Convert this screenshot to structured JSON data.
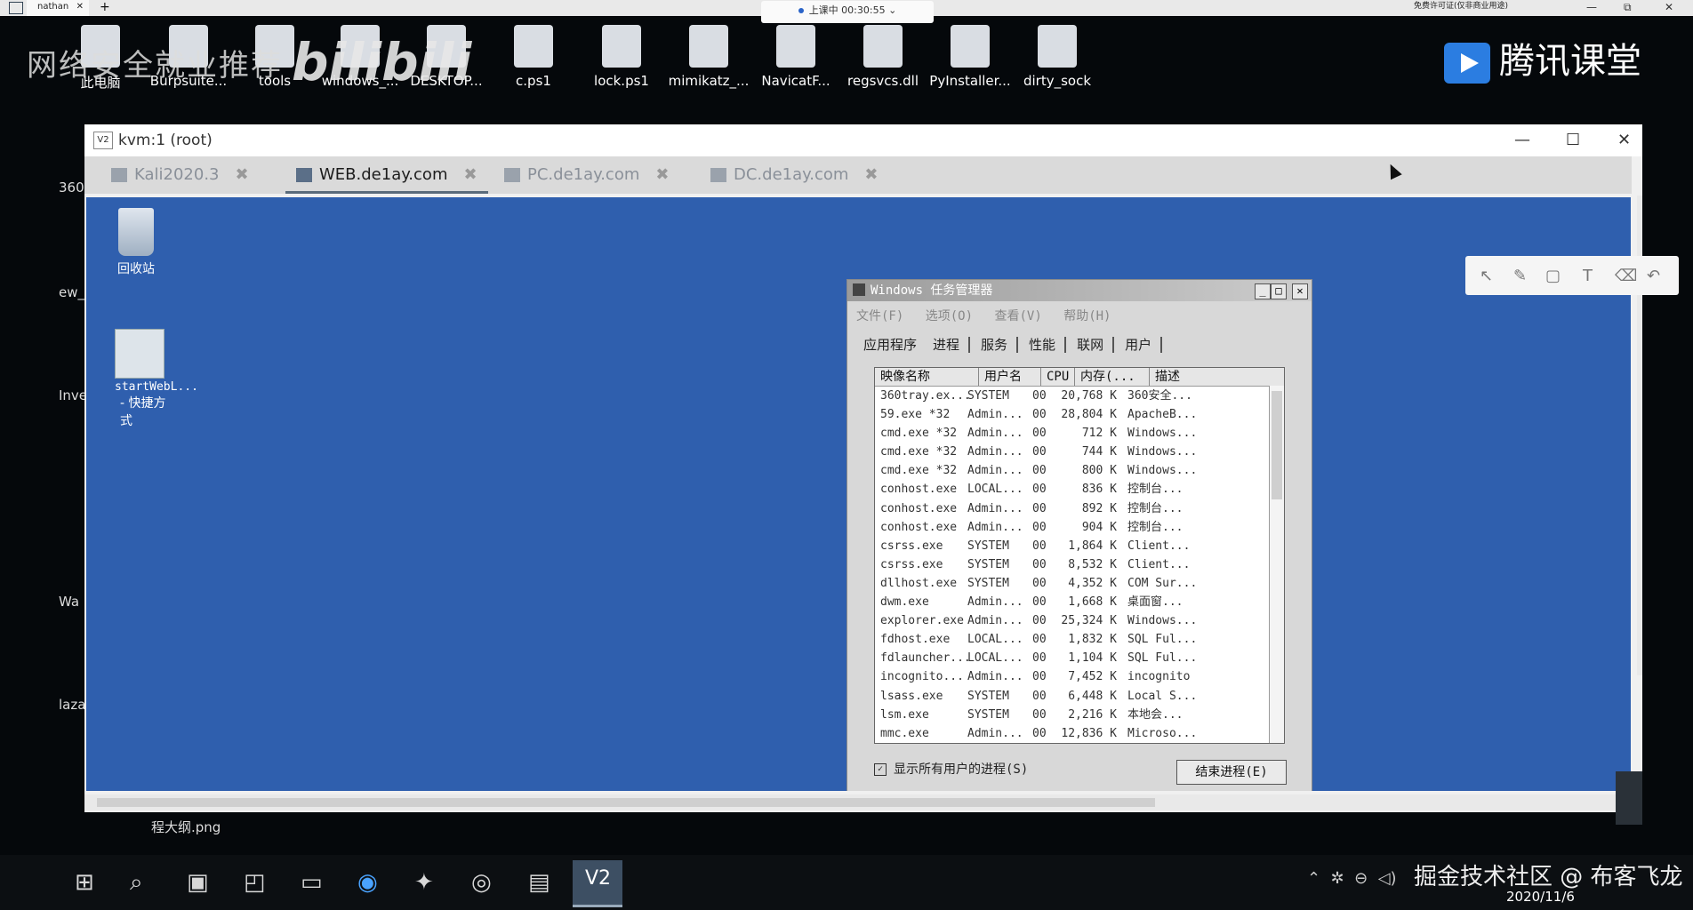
{
  "browser": {
    "tab_label": "nathan",
    "tab_close": "✕",
    "new_tab": "+",
    "class_status": "上课中 00:30:55",
    "top_right_text": "免费许可证(仅非商业用途)",
    "window_controls": [
      "—",
      "⧉",
      "✕"
    ]
  },
  "desktop_icons": [
    {
      "label": "此电脑",
      "icon": "pc-icon"
    },
    {
      "label": "Burpsuite...",
      "icon": "file-icon"
    },
    {
      "label": "tools",
      "icon": "folder-icon"
    },
    {
      "label": "windows_...",
      "icon": "file-icon"
    },
    {
      "label": "DESKTOP...",
      "icon": "file-icon"
    },
    {
      "label": "c.ps1",
      "icon": "script-icon"
    },
    {
      "label": "lock.ps1",
      "icon": "script-icon"
    },
    {
      "label": "mimikatz_...",
      "icon": "archive-icon"
    },
    {
      "label": "NavicatF...",
      "icon": "file-icon"
    },
    {
      "label": "regsvcs.dll",
      "icon": "dll-icon"
    },
    {
      "label": "PyInstaller...",
      "icon": "archive-icon"
    },
    {
      "label": "dirty_sock",
      "icon": "file-icon"
    }
  ],
  "watermark_left": "网络安全就业推荐",
  "watermark_bili": "bilibili",
  "tencent_brand": "腾讯课堂",
  "left_cut_labels": [
    "360",
    "ew_",
    "Inve",
    "Wa",
    "laza"
  ],
  "kvm": {
    "title": "kvm:1 (root)",
    "icon_text": "V2",
    "controls": [
      "—",
      "☐",
      "✕"
    ],
    "tabs": [
      {
        "label": "Kali2020.3",
        "active": false
      },
      {
        "label": "WEB.de1ay.com",
        "active": true
      },
      {
        "label": "PC.de1ay.com",
        "active": false
      },
      {
        "label": "DC.de1ay.com",
        "active": false
      }
    ],
    "tab_close": "✖"
  },
  "remote": {
    "recycle_label": "回收站",
    "shortcut_label_1": "startWebL...",
    "shortcut_label_2": "- 快捷方式"
  },
  "taskmgr": {
    "title": "Windows 任务管理器",
    "menu": [
      "文件(F)",
      "选项(O)",
      "查看(V)",
      "帮助(H)"
    ],
    "tabs": [
      "应用程序",
      "进程",
      "服务",
      "性能",
      "联网",
      "用户"
    ],
    "selected_tab": "进程",
    "columns": [
      "映像名称",
      "用户名",
      "CPU",
      "内存(...",
      "描述"
    ],
    "rows": [
      {
        "name": "360tray.ex...",
        "user": "SYSTEM",
        "cpu": "00",
        "mem": "20,768 K",
        "desc": "360安全..."
      },
      {
        "name": "59.exe *32",
        "user": "Admin...",
        "cpu": "00",
        "mem": "28,804 K",
        "desc": "ApacheB..."
      },
      {
        "name": "cmd.exe *32",
        "user": "Admin...",
        "cpu": "00",
        "mem": "712 K",
        "desc": "Windows..."
      },
      {
        "name": "cmd.exe *32",
        "user": "Admin...",
        "cpu": "00",
        "mem": "744 K",
        "desc": "Windows..."
      },
      {
        "name": "cmd.exe *32",
        "user": "Admin...",
        "cpu": "00",
        "mem": "800 K",
        "desc": "Windows..."
      },
      {
        "name": "conhost.exe",
        "user": "LOCAL...",
        "cpu": "00",
        "mem": "836 K",
        "desc": "控制台..."
      },
      {
        "name": "conhost.exe",
        "user": "Admin...",
        "cpu": "00",
        "mem": "892 K",
        "desc": "控制台..."
      },
      {
        "name": "conhost.exe",
        "user": "Admin...",
        "cpu": "00",
        "mem": "904 K",
        "desc": "控制台..."
      },
      {
        "name": "csrss.exe",
        "user": "SYSTEM",
        "cpu": "00",
        "mem": "1,864 K",
        "desc": "Client..."
      },
      {
        "name": "csrss.exe",
        "user": "SYSTEM",
        "cpu": "00",
        "mem": "8,532 K",
        "desc": "Client..."
      },
      {
        "name": "dllhost.exe",
        "user": "SYSTEM",
        "cpu": "00",
        "mem": "4,352 K",
        "desc": "COM Sur..."
      },
      {
        "name": "dwm.exe",
        "user": "Admin...",
        "cpu": "00",
        "mem": "1,668 K",
        "desc": "桌面窗..."
      },
      {
        "name": "explorer.exe",
        "user": "Admin...",
        "cpu": "00",
        "mem": "25,324 K",
        "desc": "Windows..."
      },
      {
        "name": "fdhost.exe",
        "user": "LOCAL...",
        "cpu": "00",
        "mem": "1,832 K",
        "desc": "SQL Ful..."
      },
      {
        "name": "fdlauncher...",
        "user": "LOCAL...",
        "cpu": "00",
        "mem": "1,104 K",
        "desc": "SQL Ful..."
      },
      {
        "name": "incognito...",
        "user": "Admin...",
        "cpu": "00",
        "mem": "7,452 K",
        "desc": "incognito"
      },
      {
        "name": "lsass.exe",
        "user": "SYSTEM",
        "cpu": "00",
        "mem": "6,448 K",
        "desc": "Local S..."
      },
      {
        "name": "lsm.exe",
        "user": "SYSTEM",
        "cpu": "00",
        "mem": "2,216 K",
        "desc": "本地会..."
      },
      {
        "name": "mmc.exe",
        "user": "Admin...",
        "cpu": "00",
        "mem": "12,836 K",
        "desc": "Microso..."
      }
    ],
    "show_all_label": "显示所有用户的进程(S)",
    "show_all_checked": true,
    "end_button": "结束进程(E)"
  },
  "draw_tools": [
    "pointer-icon",
    "pen-icon",
    "shape-icon",
    "text-icon",
    "eraser-icon",
    "undo-icon"
  ],
  "file_label": "程大纲.png",
  "taskbar": {
    "date": "2020/11/6",
    "watermark": "掘金技术社区 @ 布客飞龙"
  }
}
